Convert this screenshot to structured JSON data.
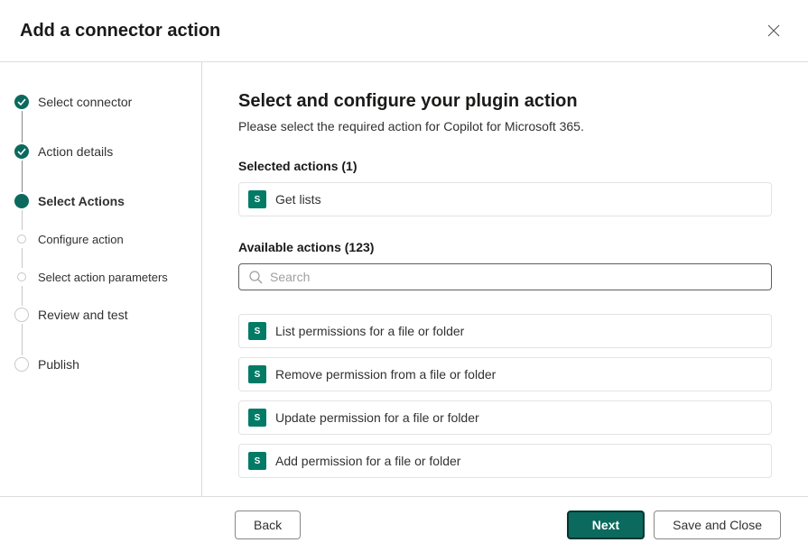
{
  "header": {
    "title": "Add a connector action"
  },
  "steps": [
    {
      "label": "Select connector",
      "state": "done"
    },
    {
      "label": "Action details",
      "state": "done"
    },
    {
      "label": "Select Actions",
      "state": "current"
    },
    {
      "label": "Configure action",
      "state": "sub"
    },
    {
      "label": "Select action parameters",
      "state": "sub"
    },
    {
      "label": "Review and test",
      "state": "future"
    },
    {
      "label": "Publish",
      "state": "future"
    }
  ],
  "main": {
    "title": "Select and configure your plugin action",
    "subtitle": "Please select the required action for Copilot for Microsoft 365.",
    "selected_label": "Selected actions (1)",
    "available_label": "Available actions (123)",
    "search_placeholder": "Search"
  },
  "icon_glyph": "S",
  "selected_actions": [
    {
      "label": "Get lists"
    }
  ],
  "available_actions": [
    {
      "label": "List permissions for a file or folder"
    },
    {
      "label": "Remove permission from a file or folder"
    },
    {
      "label": "Update permission for a file or folder"
    },
    {
      "label": "Add permission for a file or folder"
    }
  ],
  "footer": {
    "back": "Back",
    "next": "Next",
    "save": "Save and Close"
  }
}
